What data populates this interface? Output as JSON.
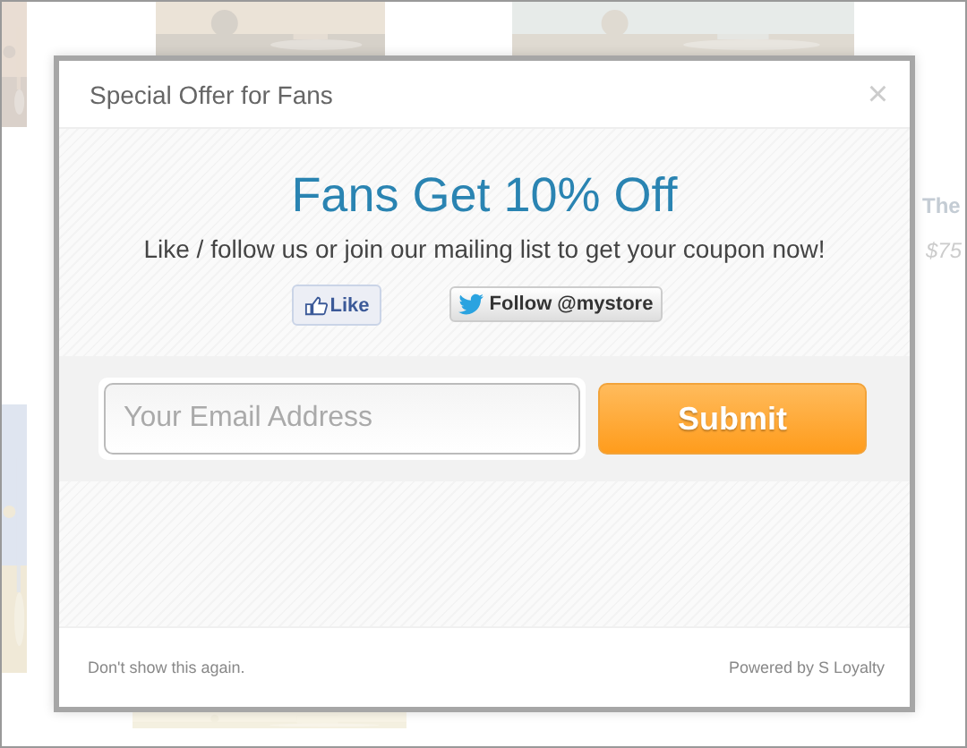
{
  "background_page": {
    "product_title": "The",
    "product_price": "$75"
  },
  "modal": {
    "title": "Special Offer for Fans",
    "close": "×",
    "headline": "Fans Get 10% Off",
    "subtitle": "Like / follow us or join our mailing list to get your coupon now!",
    "like_button": "Like",
    "follow_button": "Follow @mystore",
    "email": {
      "placeholder": "Your Email Address"
    },
    "submit": "Submit",
    "footer_left": "Don't show this again.",
    "footer_right": "Powered by S Loyalty"
  }
}
